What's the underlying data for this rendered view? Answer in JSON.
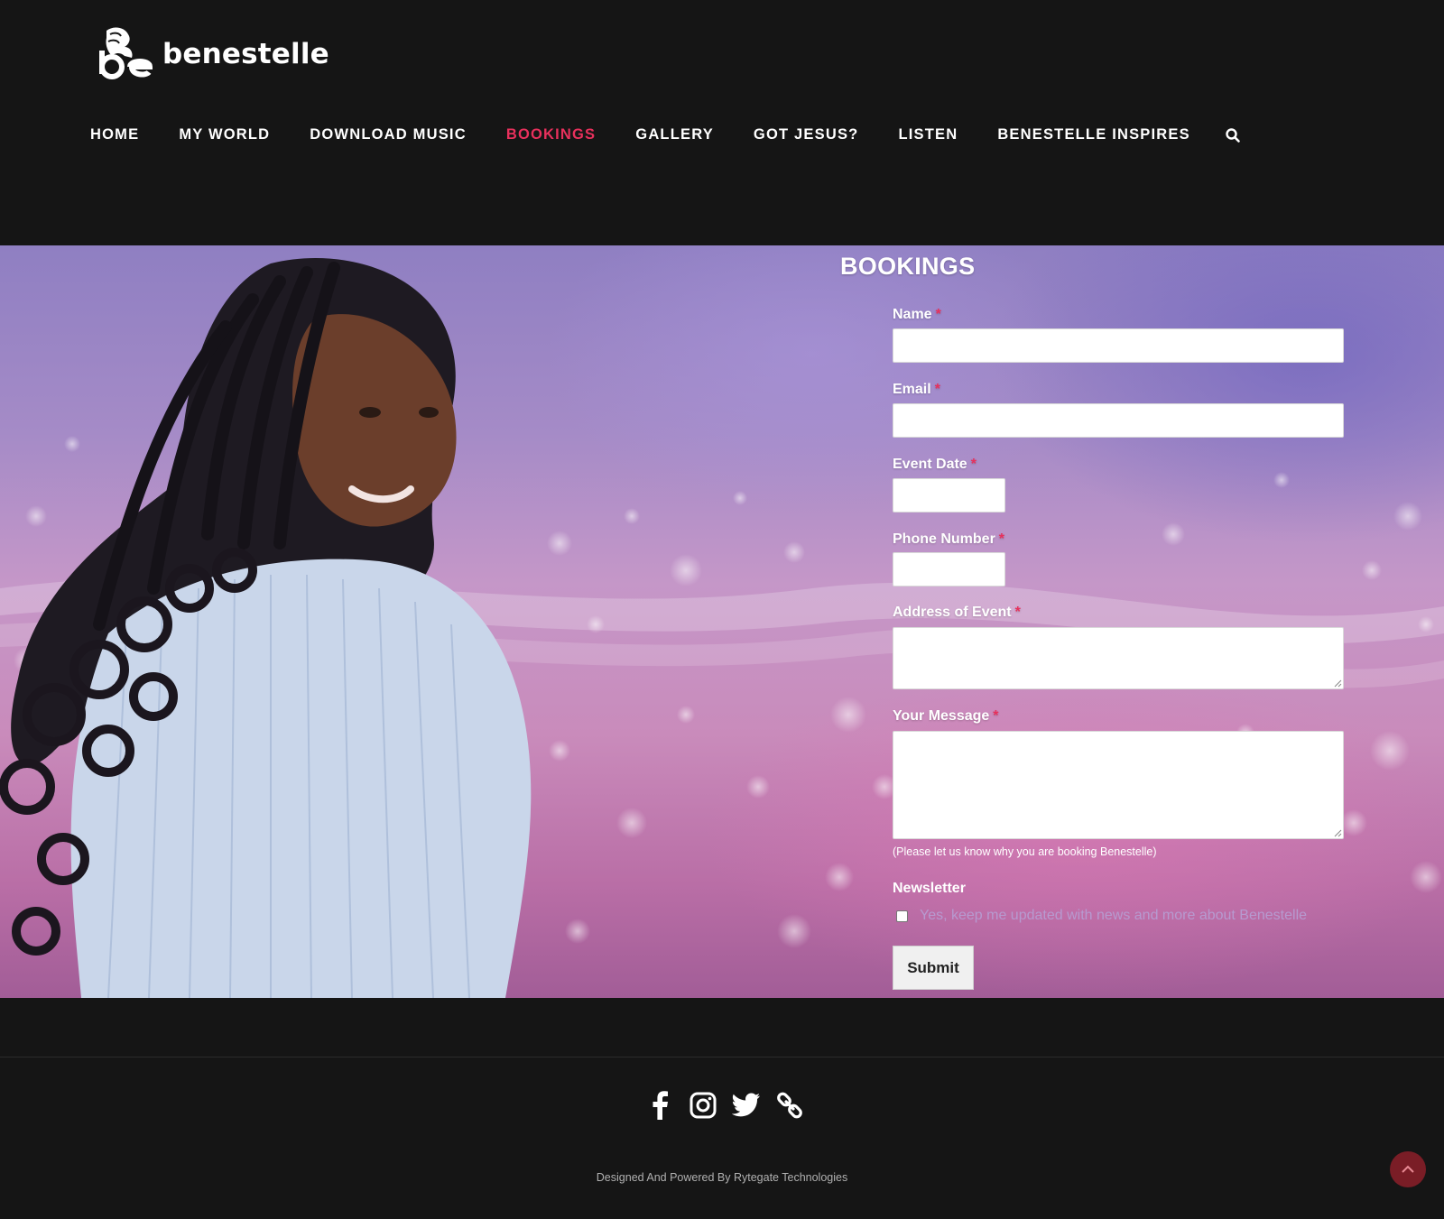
{
  "brand": {
    "name": "benestelle"
  },
  "nav": {
    "items": [
      {
        "label": "HOME",
        "active": false
      },
      {
        "label": "MY WORLD",
        "active": false
      },
      {
        "label": "DOWNLOAD MUSIC",
        "active": false
      },
      {
        "label": "BOOKINGS",
        "active": true
      },
      {
        "label": "GALLERY",
        "active": false
      },
      {
        "label": "GOT JESUS?",
        "active": false
      },
      {
        "label": "LISTEN",
        "active": false
      },
      {
        "label": "BENESTELLE INSPIRES",
        "active": false
      }
    ],
    "search_icon": "search-icon"
  },
  "form": {
    "title": "BOOKINGS",
    "required_mark": "*",
    "fields": {
      "name": {
        "label": "Name",
        "value": ""
      },
      "email": {
        "label": "Email",
        "value": ""
      },
      "event_date": {
        "label": "Event Date",
        "value": ""
      },
      "phone": {
        "label": "Phone Number",
        "value": ""
      },
      "address": {
        "label": "Address of Event",
        "value": ""
      },
      "message": {
        "label": "Your Message",
        "value": "",
        "hint": "(Please let us know why you are booking Benestelle)"
      }
    },
    "newsletter": {
      "label": "Newsletter",
      "checkbox_text": "Yes, keep me updated with news and more about Benestelle",
      "checked": false
    },
    "submit_label": "Submit"
  },
  "footer": {
    "socials": [
      "facebook-icon",
      "instagram-icon",
      "twitter-icon",
      "link-icon"
    ],
    "credit": "Designed And Powered By Rytegate Technologies"
  },
  "colors": {
    "accent": "#e8305c",
    "background": "#151515",
    "to_top": "#7a1d26"
  }
}
